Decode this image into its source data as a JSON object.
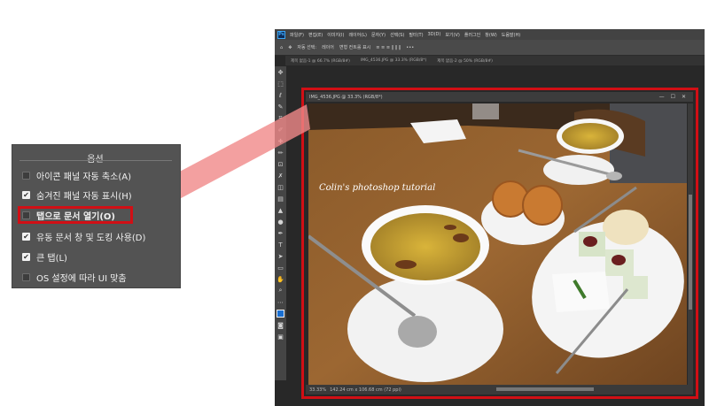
{
  "options_panel": {
    "title": "옵션",
    "items": [
      {
        "label": "아이콘 패널 자동 축소(A)",
        "checked": false
      },
      {
        "label": "숨겨진 패널 자동 표시(H)",
        "checked": true
      },
      {
        "label": "탭으로 문서 열기(O)",
        "checked": false,
        "highlighted": true
      },
      {
        "label": "유동 문서 창 및 도킹 사용(D)",
        "checked": true
      },
      {
        "label": "큰 탭(L)",
        "checked": true
      },
      {
        "label": "OS 설정에 따라 UI 맞춤",
        "checked": false
      }
    ]
  },
  "photoshop": {
    "logo": "Ps",
    "menus": [
      "파일(F)",
      "편집(E)",
      "이미지(I)",
      "레이어(L)",
      "문자(Y)",
      "선택(S)",
      "필터(T)",
      "3D(D)",
      "보기(V)",
      "플러그인",
      "창(W)",
      "도움말(H)"
    ],
    "options_bar": {
      "auto_select": "자동 선택:",
      "target": "레이어",
      "transform": "변형 컨트롤 표시"
    },
    "tabs": [
      "제목 없음-1 @ 66.7% (RGB/8#)",
      "IMG_4536.JPG @ 33.3% (RGB/8*)",
      "제목 없음-2 @ 50% (RGB/8#)"
    ],
    "document": {
      "title": "IMG_4536.JPG @ 33.3% (RGB/8*)",
      "caption": "Colin's photoshop tutorial",
      "zoom": "33.33%",
      "size": "142.24 cm x 106.68 cm (72 ppi)"
    }
  },
  "colors": {
    "highlight": "#d10f15",
    "panel_bg": "#535353",
    "ps_bg": "#282828"
  }
}
